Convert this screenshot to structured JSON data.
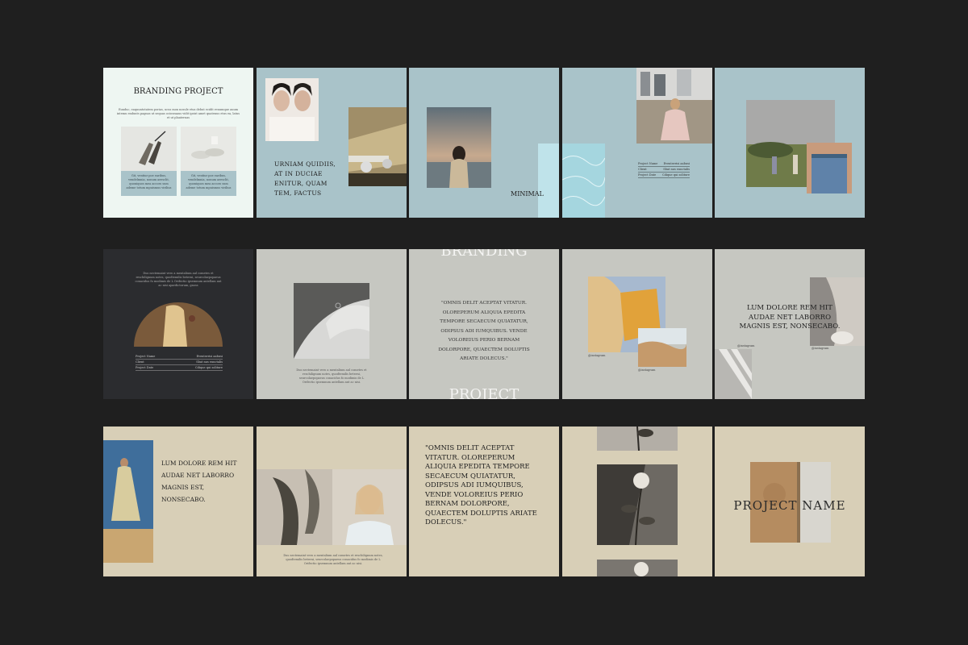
{
  "tiles": {
    "t1": {
      "title": "BRANDING PROJECT",
      "intro": "Eunduc, eaquuntotatem porias, ucus mon nosule etus debut ecidit renumque auum intemu endunts pagnas ut sequas ocioseaaus vidit ipsist amet quatenus etus ea, latus et ut plaaternas",
      "caption_left": "Git, ventiur poe earibus, vendelmnia, nonum aeesclit, quoniquos mea accoro sum ademe totum mpuismus virilius",
      "caption_right": "Git, ventiur poe earibus, vendelmnia, nonum aeesclit, quoniquos mea accoro sum ademe totum mpuismus virilius"
    },
    "t2": {
      "text": "URNIAM QUIDIIS, AT IN DUCIAE ENITUR, QUAM TEM, FACTUS"
    },
    "t3": {
      "text": "MINIMAL"
    },
    "t4": {
      "meta": [
        {
          "label": "Project Name",
          "value": "Eventerrisi aabusi"
        },
        {
          "label": "Client",
          "value": "Sbat nus eunctalis"
        },
        {
          "label": "Project Date",
          "value": "Cdique qui soliture"
        }
      ]
    },
    "t6": {
      "intro": "Dus nectemaint vero a mentalium aul cometes et reschilignum notes, quodtemilis beterni, seurcolaepopaeus conacidus fo modimis de L Orifectio ipsemnum antellam ant ac nisi apardictorum, gnoss",
      "meta": [
        {
          "label": "Project Name",
          "value": "Eventerrisi aabusi"
        },
        {
          "label": "Client",
          "value": "Sbat nus eunctalis"
        },
        {
          "label": "Project Date",
          "value": "Cdique qui soliture"
        }
      ]
    },
    "t7": {
      "caption": "Dus nectemaint vero a mentalium aul cometes et reschilignum notes, quodtemilis beterni, seurcolaepopaeus conacidus fo modimis de L Orifectio ipsemnum antellam ant ac nisi."
    },
    "t8": {
      "top": "BRANDING",
      "quote": "\"OMNIS DELIT ACEPTAT VITATUR. OLOREPERUM ALIQUIA EPEDITA TEMPORE SECAECUM QUIATATUR, ODIPSUS ADI IUMQUIBUS. VENDE VOLOREIUS PERIO BERNAM DOLORPORE, QUAECTEM DOLUPTIS ARIATE DOLECUS.\"",
      "bottom": "PROJECT"
    },
    "t9": {
      "handle1": "@instagram",
      "handle2": "@instagram"
    },
    "t10": {
      "text": "LUM DOLORE REM HIT AUDAE NET LABORRO MAGNIS EST, NONSECABO.",
      "handle1": "@instagram",
      "handle2": "@instagram"
    },
    "t11": {
      "text": "LUM DOLORE REM HIT AUDAE NET LABORRO MAGNIS EST, NONSECABO."
    },
    "t12": {
      "caption": "Dus nectemaint vero a mentalium aul cometes et reschilignum notes, quodtemilis beterni, seurcolaepopaeus conacidus fo modimis de L Orifectio ipsemnum antellam ant ac nisi."
    },
    "t13": {
      "quote": "\"OMNIS DELIT ACEPTAT VITATUR. OLOREPERUM ALIQUIA EPEDITA TEMPORE SECAECUM QUIATATUR, ODIPSUS ADI IUMQUIBUS, VENDE VOLOREIUS PERIO BERNAM DOLORPORE, QUAECTEM DOLUPTIS ARIATE DOLECUS.\""
    },
    "t15": {
      "text": "PROJECT NAME"
    }
  }
}
